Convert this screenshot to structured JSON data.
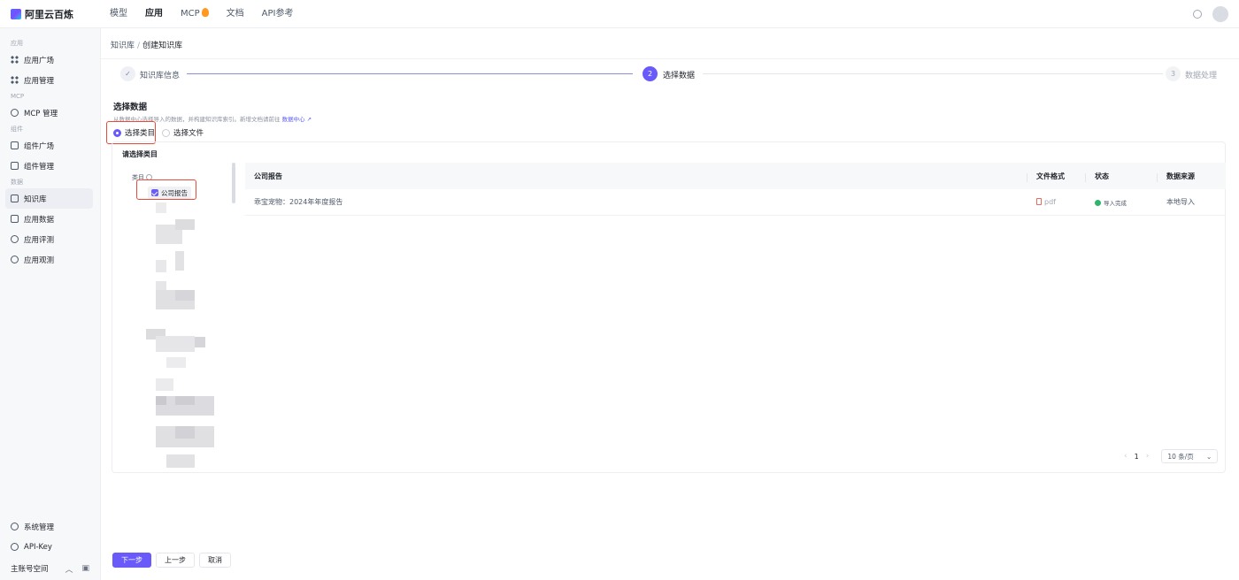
{
  "brand": {
    "name": "阿里云百炼"
  },
  "topnav": [
    {
      "label": "模型",
      "active": false
    },
    {
      "label": "应用",
      "active": true
    },
    {
      "label": "MCP",
      "active": false
    },
    {
      "label": "文档",
      "active": false
    },
    {
      "label": "API参考",
      "active": false
    }
  ],
  "sidebar": {
    "groups": [
      {
        "label": "应用",
        "items": [
          "应用广场",
          "应用管理"
        ]
      },
      {
        "label": "MCP",
        "items": [
          "MCP 管理"
        ]
      },
      {
        "label": "组件",
        "items": [
          "组件广场",
          "组件管理"
        ]
      },
      {
        "label": "数据",
        "items": [
          "知识库",
          "应用数据",
          "应用评测",
          "应用观测"
        ]
      }
    ],
    "active_item": "知识库",
    "bottom_items": [
      "系统管理",
      "API-Key"
    ],
    "footer_label": "主账号空间"
  },
  "breadcrumb": {
    "parent": "知识库",
    "separator": "/",
    "current": "创建知识库"
  },
  "steps": [
    {
      "index": "✓",
      "label": "知识库信息",
      "state": "done"
    },
    {
      "index": "2",
      "label": "选择数据",
      "state": "current"
    },
    {
      "index": "3",
      "label": "数据处理",
      "state": "todo"
    }
  ],
  "section": {
    "title": "选择数据",
    "desc": "从数据中心选择导入的数据，并构建知识库索引。新增文档请前往",
    "link": "数据中心 ↗"
  },
  "radio": {
    "option_category": "选择类目",
    "option_file": "选择文件",
    "selected": "选择类目"
  },
  "category_panel": {
    "title": "请选择类目",
    "tree_header": "类目",
    "checked_node": "公司报告"
  },
  "table": {
    "headers": [
      "公司报告",
      "文件格式",
      "状态",
      "数据来源"
    ],
    "rows": [
      {
        "name": "乖宝宠物：2024年年度报告",
        "format": "pdf",
        "status": "导入完成",
        "source": "本地导入"
      }
    ]
  },
  "pager": {
    "prev": "‹",
    "page": "1",
    "next": "›",
    "page_size": "10 条/页",
    "dropdown": "⌄"
  },
  "footer": {
    "next": "下一步",
    "prev": "上一步",
    "cancel": "取消"
  },
  "colors": {
    "accent": "#6a5af9",
    "highlight": "#e34d3a",
    "success": "#2fb36e"
  }
}
